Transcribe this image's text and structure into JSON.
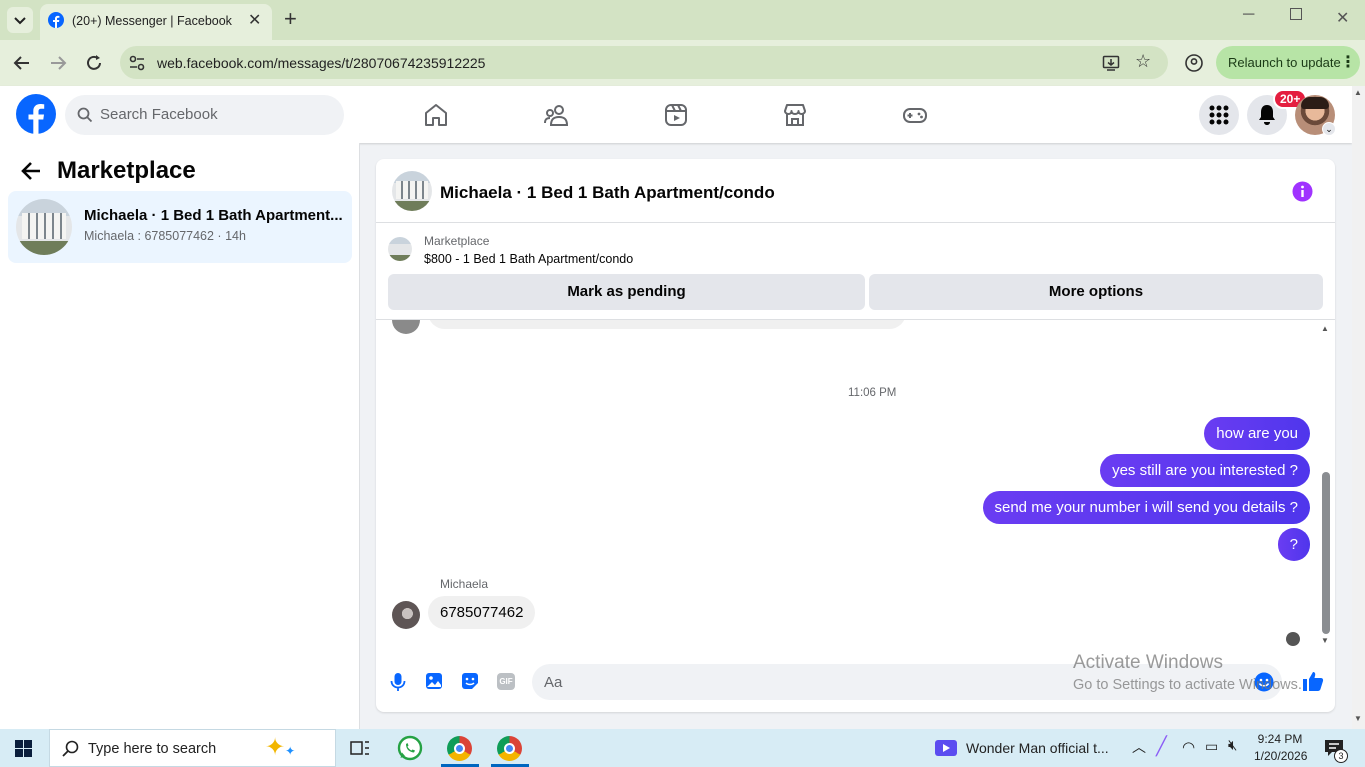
{
  "browser": {
    "tab_title": "(20+) Messenger | Facebook",
    "url": "web.facebook.com/messages/t/28070674235912225",
    "relaunch_label": "Relaunch to update"
  },
  "fb": {
    "search_placeholder": "Search Facebook",
    "notification_count": "20+"
  },
  "sidebar": {
    "title": "Marketplace",
    "conversation": {
      "name": "Michaela · 1 Bed 1 Bath Apartment...",
      "preview": "Michaela : 6785077462 · 14h"
    }
  },
  "chat": {
    "header_title": "Michaela · 1 Bed 1 Bath Apartment/condo",
    "listing_source": "Marketplace",
    "listing_title": "$800 - 1 Bed 1 Bath Apartment/condo",
    "mark_pending_label": "Mark as pending",
    "more_options_label": "More options",
    "timestamp": "11:06 PM",
    "outgoing": [
      "how are you",
      "yes still are you interested ?",
      "send me your number i will send you details ?",
      "?"
    ],
    "incoming_sender": "Michaela",
    "incoming_message": "6785077462",
    "composer_placeholder": "Aa"
  },
  "watermark": {
    "line1": "Activate Windows",
    "line2": "Go to Settings to activate Windows."
  },
  "taskbar": {
    "search_placeholder": "Type here to search",
    "media_title": "Wonder Man official t...",
    "time": "9:24 PM",
    "date": "1/20/2026",
    "notif_count": "3"
  },
  "colors": {
    "fb_blue": "#0866ff",
    "bubble_purple": "#5b37f0",
    "badge_red": "#e41e3f",
    "info_purple": "#a033ff"
  }
}
